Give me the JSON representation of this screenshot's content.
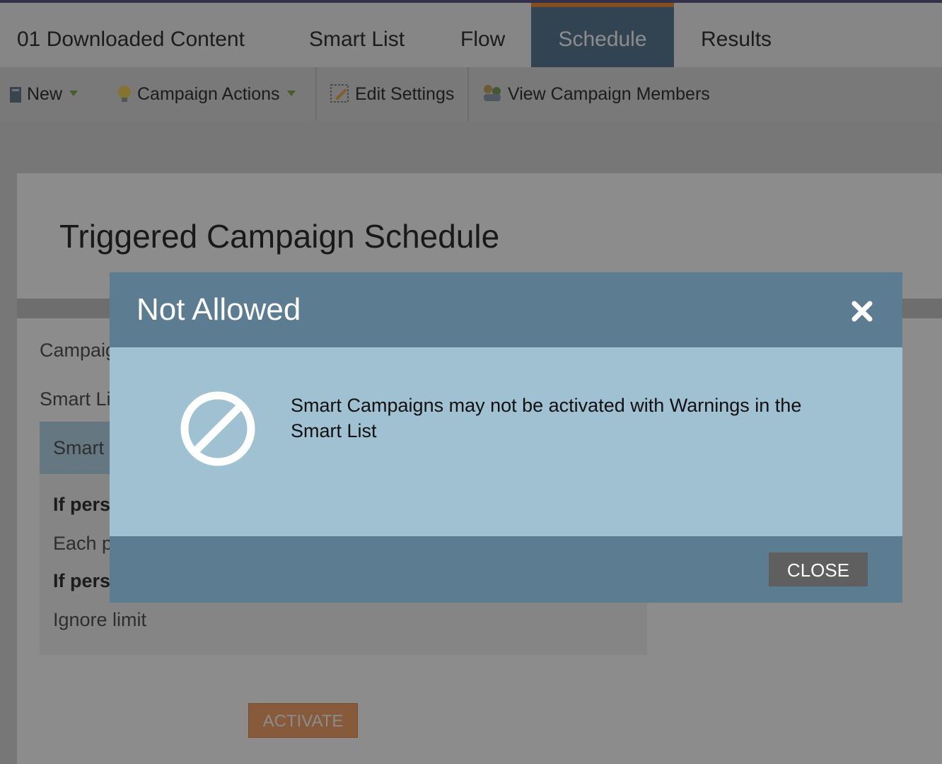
{
  "tabs": [
    {
      "label": "01 Downloaded Content"
    },
    {
      "label": "Smart List"
    },
    {
      "label": "Flow"
    },
    {
      "label": "Schedule"
    },
    {
      "label": "Results"
    }
  ],
  "toolbar": {
    "new_label": "New",
    "campaign_actions_label": "Campaign Actions",
    "edit_settings_label": "Edit Settings",
    "view_members_label": "View Campaign Members"
  },
  "page": {
    "title": "Triggered Campaign Schedule",
    "rows": {
      "campaign": "Campaign",
      "smart_list": "Smart List",
      "smart_box": "Smart",
      "if_person_1": "If pers",
      "each_person": "Each p",
      "if_person_2": "If pers",
      "ignore_limit": "Ignore limit"
    },
    "activate_label": "ACTIVATE"
  },
  "dialog": {
    "title": "Not Allowed",
    "message": "Smart Campaigns may not be activated with Warnings in the Smart List",
    "close_label": "CLOSE"
  },
  "colors": {
    "dialog_header": "#5c7c91",
    "dialog_body": "#a0c1d2",
    "active_tab_accent": "#f08a3c",
    "activate_button": "#f4a46b"
  }
}
